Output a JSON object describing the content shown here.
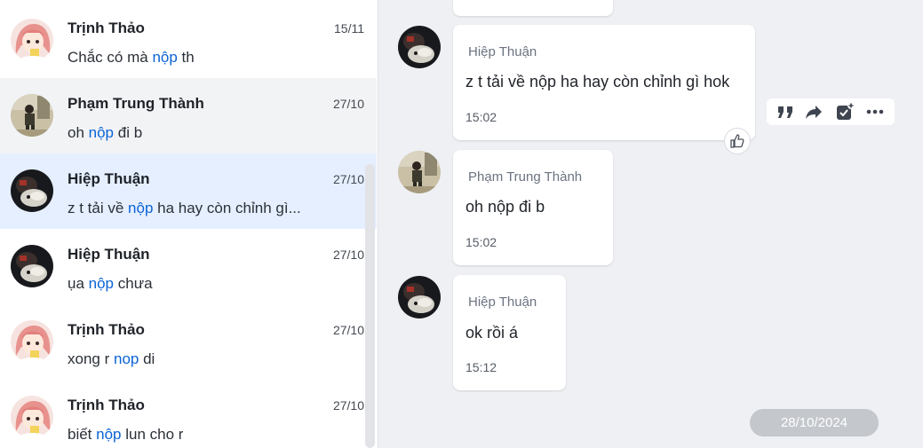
{
  "conversations": [
    {
      "name": "Trịnh Thảo",
      "date": "15/11",
      "before": "Chắc có mà ",
      "match": "nộp",
      "after": " th"
    },
    {
      "name": "Phạm Trung Thành",
      "date": "27/10",
      "before": "oh ",
      "match": "nộp",
      "after": " đi b"
    },
    {
      "name": "Hiệp Thuận",
      "date": "27/10",
      "before": "z t tải về ",
      "match": "nộp",
      "after": " ha hay còn chỉnh gì..."
    },
    {
      "name": "Hiệp Thuận",
      "date": "27/10",
      "before": "ụa ",
      "match": "nộp",
      "after": " chưa"
    },
    {
      "name": "Trịnh Thảo",
      "date": "27/10",
      "before": "xong r ",
      "match": "nop",
      "after": " di"
    },
    {
      "name": "Trịnh Thảo",
      "date": "27/10",
      "before": "biết ",
      "match": "nộp",
      "after": " lun cho r"
    }
  ],
  "messages": [
    {
      "sender": "Hiệp Thuận",
      "text": "z t tải về nộp ha hay còn chỉnh gì hok",
      "time": "15:02"
    },
    {
      "sender": "Phạm Trung Thành",
      "text": "oh nộp đi b",
      "time": "15:02"
    },
    {
      "sender": "Hiệp Thuận",
      "text": "ok rồi á",
      "time": "15:12"
    }
  ],
  "date_separator": "28/10/2024",
  "icons": {
    "quote": "quote-icon",
    "forward": "forward-icon",
    "task": "task-icon",
    "more": "more-icon",
    "like": "thumbs-up-icon"
  },
  "colors": {
    "highlight": "#0a63d6",
    "active_row": "#e5efff",
    "hover_row": "#f2f3f5",
    "chat_bg": "#eef0f3"
  }
}
